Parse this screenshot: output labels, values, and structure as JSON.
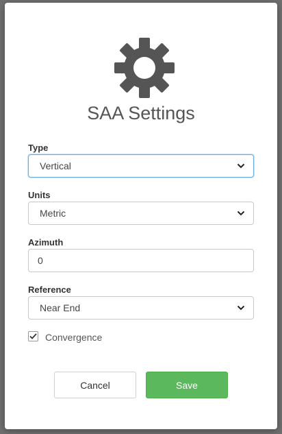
{
  "dialog": {
    "title": "SAA Settings",
    "icon": "gear-icon"
  },
  "fields": {
    "type": {
      "label": "Type",
      "value": "Vertical"
    },
    "units": {
      "label": "Units",
      "value": "Metric"
    },
    "azimuth": {
      "label": "Azimuth",
      "value": "0"
    },
    "reference": {
      "label": "Reference",
      "value": "Near End"
    }
  },
  "convergence": {
    "label": "Convergence",
    "checked": true
  },
  "buttons": {
    "cancel": "Cancel",
    "save": "Save"
  },
  "colors": {
    "save_button": "#5cb85c",
    "focus_border": "#66afe9",
    "icon": "#555555"
  }
}
